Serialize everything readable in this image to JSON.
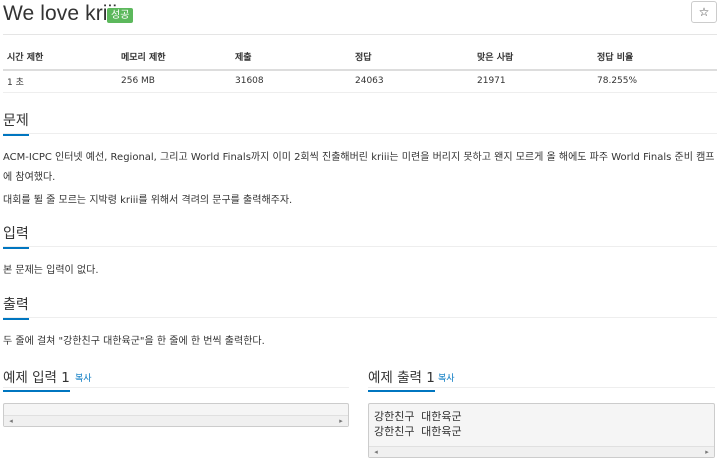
{
  "problem": {
    "title": "We love kriii",
    "status_badge": "성공",
    "star_icon": "☆"
  },
  "info_table": {
    "headers": [
      "시간 제한",
      "메모리 제한",
      "제출",
      "정답",
      "맞은 사람",
      "정답 비율"
    ],
    "values": [
      "1 초",
      "256 MB",
      "31608",
      "24063",
      "21971",
      "78.255%"
    ]
  },
  "sections": {
    "description": {
      "heading": "문제",
      "paragraphs": [
        "ACM-ICPC 인터넷 예선, Regional, 그리고 World Finals까지 이미 2회씩 진출해버린 kriii는 미련을 버리지 못하고 왠지 모르게 올 해에도 파주 World Finals 준비 캠프에 참여했다.",
        "대회를 뛸 줄 모르는 지박령 kriii를 위해서 격려의 문구를 출력해주자."
      ]
    },
    "input": {
      "heading": "입력",
      "text": "본 문제는 입력이 없다."
    },
    "output": {
      "heading": "출력",
      "text": "두 줄에 걸쳐 \"강한친구 대한육군\"을 한 줄에 한 번씩 출력한다."
    }
  },
  "samples": {
    "input": {
      "heading": "예제 입력 1",
      "copy_label": "복사",
      "content": ""
    },
    "output": {
      "heading": "예제 출력 1",
      "copy_label": "복사",
      "content": "강한친구 대한육군\n강한친구 대한육군"
    }
  },
  "scroll_arrows": {
    "left": "◂",
    "right": "▸"
  }
}
